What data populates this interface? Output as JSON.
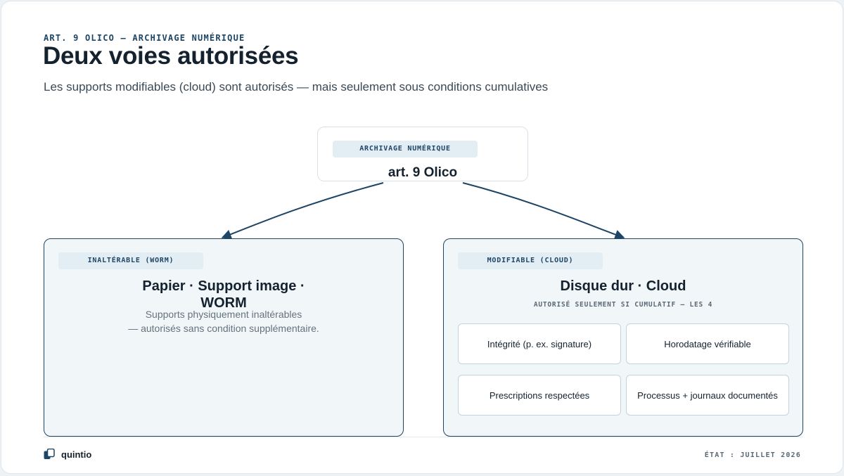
{
  "header": {
    "eyebrow": "ART. 9 OLICO — ARCHIVAGE NUMÉRIQUE",
    "title": "Deux voies autorisées",
    "subtitle": "Les supports modifiables (cloud) sont autorisés — mais seulement sous conditions cumulatives"
  },
  "root": {
    "tag": "ARCHIVAGE NUMÉRIQUE",
    "title": "art. 9 Olico"
  },
  "left_branch": {
    "tag": "INALTÉRABLE (WORM)",
    "title": "Papier · Support image · WORM",
    "description_line1": "Supports physiquement inaltérables",
    "description_line2": "— autorisés sans condition supplémentaire."
  },
  "right_branch": {
    "tag": "MODIFIABLE (CLOUD)",
    "title": "Disque dur · Cloud",
    "note": "AUTORISÉ SEULEMENT SI CUMULATIF — LES 4",
    "conditions": [
      "Intégrité (p. ex. signature)",
      "Horodatage vérifiable",
      "Prescriptions respectées",
      "Processus + journaux documentés"
    ]
  },
  "footer": {
    "brand": "quintio",
    "status": "ÉTAT : JUILLET 2026"
  },
  "colors": {
    "accent": "#1d4566",
    "branch_fill": "#f1f6f9",
    "tag_fill": "#e3edf4"
  }
}
